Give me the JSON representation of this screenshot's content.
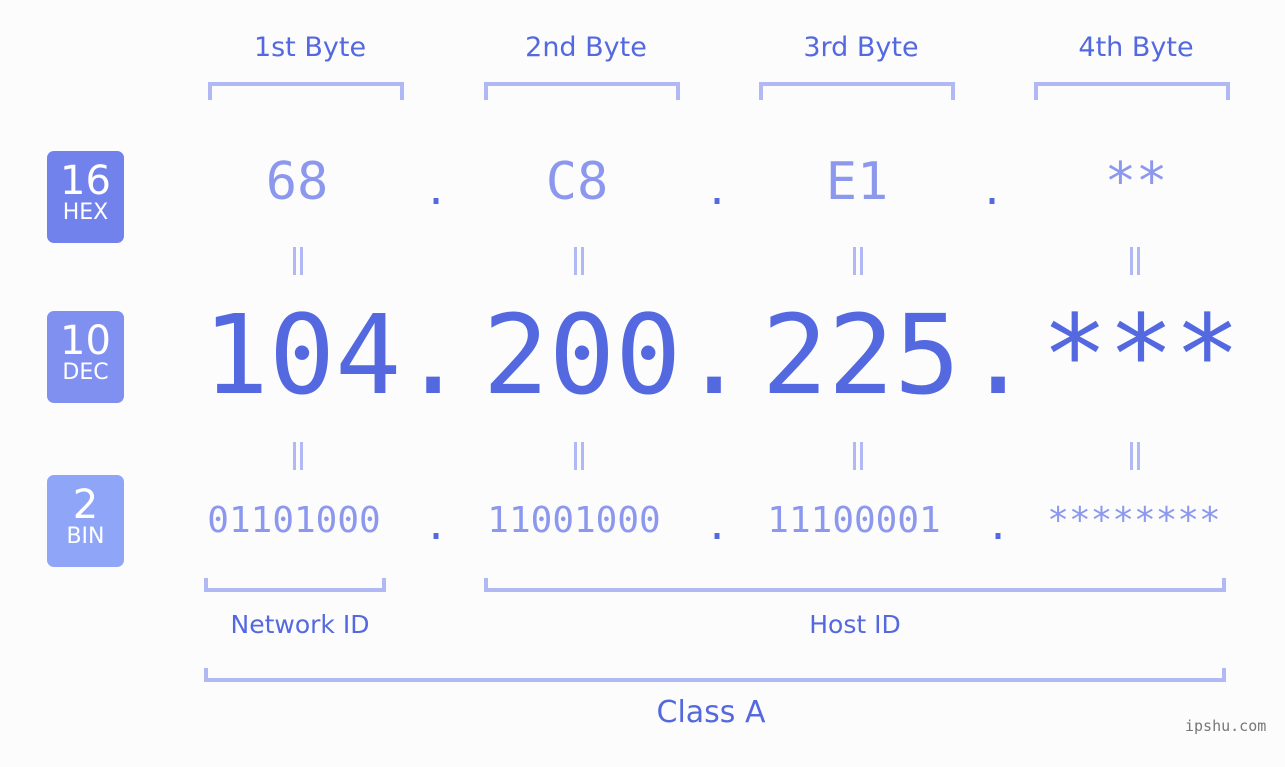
{
  "headers": [
    "1st Byte",
    "2nd Byte",
    "3rd Byte",
    "4th Byte"
  ],
  "badges": {
    "hex": {
      "num": "16",
      "label": "HEX",
      "color": "#7282ec"
    },
    "dec": {
      "num": "10",
      "label": "DEC",
      "color": "#8090f0"
    },
    "bin": {
      "num": "2",
      "label": "BIN",
      "color": "#8fa5f8"
    }
  },
  "separator": ".",
  "hex": [
    "68",
    "C8",
    "E1",
    "**"
  ],
  "dec": [
    "104",
    "200",
    "225",
    "***"
  ],
  "bin": [
    "01101000",
    "11001000",
    "11100001",
    "********"
  ],
  "labels": {
    "network": "Network ID",
    "host": "Host ID",
    "class": "Class A"
  },
  "watermark": "ipshu.com",
  "colors": {
    "primary": "#5468e0",
    "light": "#8c98ee",
    "bracket": "#b0b9f4"
  }
}
